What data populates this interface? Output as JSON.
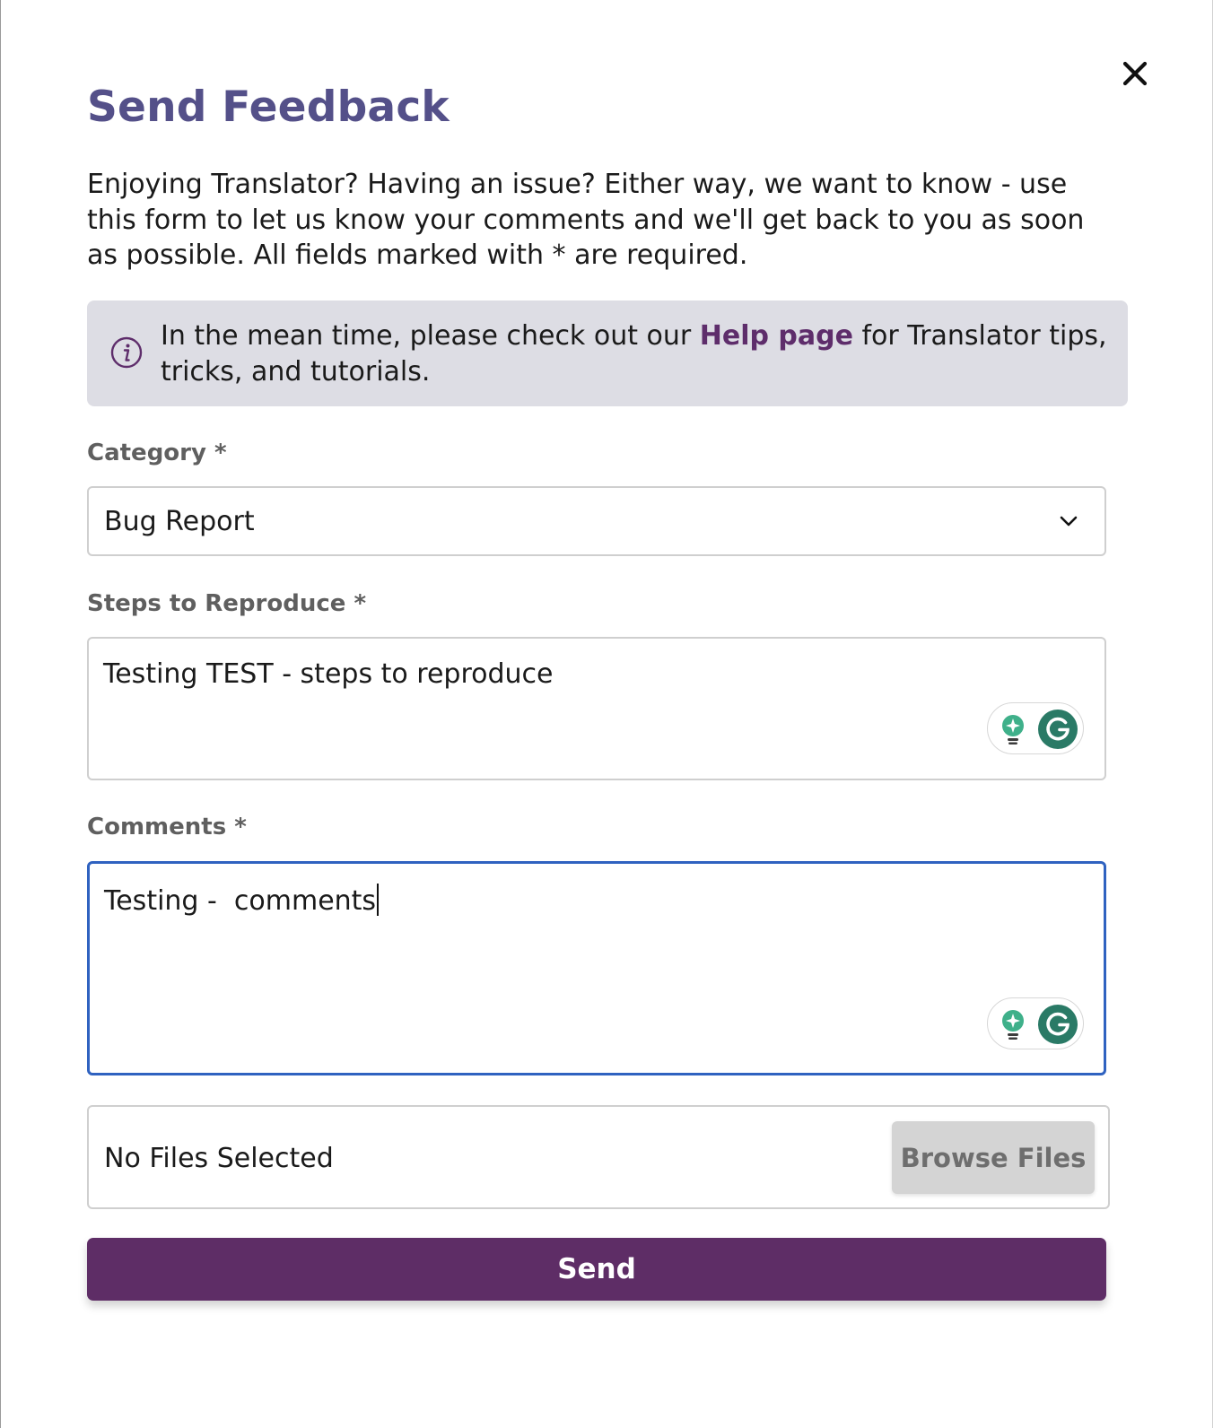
{
  "dialog": {
    "title": "Send Feedback",
    "intro": "Enjoying Translator? Having an issue? Either way, we want to know - use this form to let us know your comments and we'll get back to you as soon as possible. All fields marked with * are required.",
    "close_icon": "close-icon"
  },
  "info": {
    "icon": "info-icon",
    "text_before": "In the mean time, please check out our ",
    "link_text": "Help page",
    "text_after": " for Translator tips, tricks, and tutorials."
  },
  "form": {
    "category": {
      "label": "Category *",
      "selected": "Bug Report",
      "icon": "chevron-down-icon"
    },
    "steps": {
      "label": "Steps to Reproduce *",
      "value": "Testing TEST - steps to reproduce"
    },
    "comments": {
      "label": "Comments *",
      "value": "Testing -  comments"
    },
    "files": {
      "status": "No Files Selected",
      "browse_label": "Browse Files"
    },
    "send_label": "Send"
  },
  "colors": {
    "title": "#545089",
    "link": "#5e2d6b",
    "send_button": "#5e2d66",
    "focus_border": "#2f62c0",
    "info_background": "#dddde4",
    "grammarly_green": "#2a8a72"
  }
}
